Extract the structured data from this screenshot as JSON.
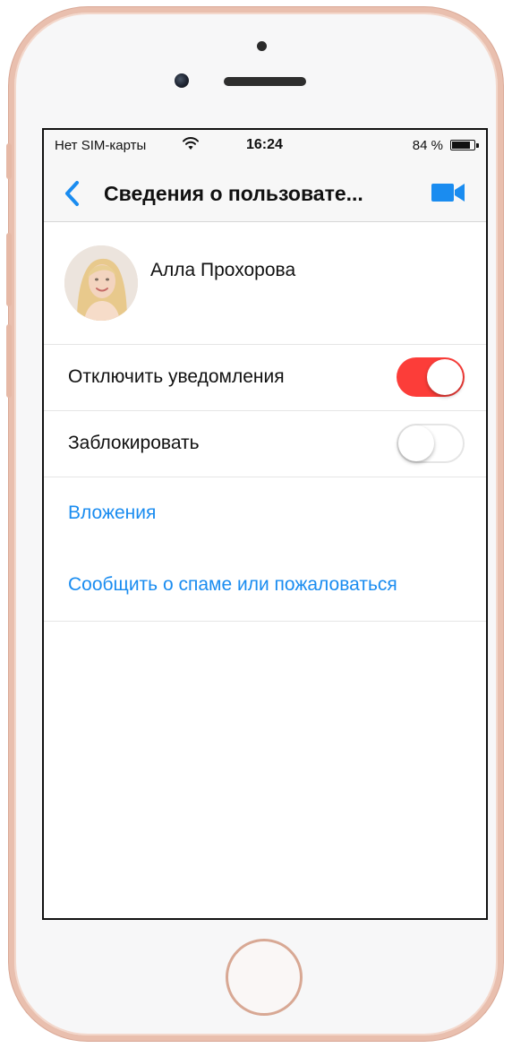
{
  "status_bar": {
    "carrier": "Нет SIM-карты",
    "time": "16:24",
    "battery": "84 %",
    "battery_level": 0.84
  },
  "nav": {
    "title": "Сведения о пользовате...",
    "back_icon": "chevron-left-icon",
    "video_icon": "video-camera-icon"
  },
  "profile": {
    "name": "Алла Прохорова"
  },
  "settings": {
    "mute": {
      "label": "Отключить уведомления",
      "enabled": true
    },
    "block": {
      "label": "Заблокировать",
      "enabled": false
    }
  },
  "links": {
    "attachments": "Вложения",
    "report": "Сообщить о спаме или пожаловаться"
  },
  "colors": {
    "accent": "#1a8cf0",
    "toggle_on": "#fc3d39",
    "phone_frame": "#e9bfae"
  }
}
